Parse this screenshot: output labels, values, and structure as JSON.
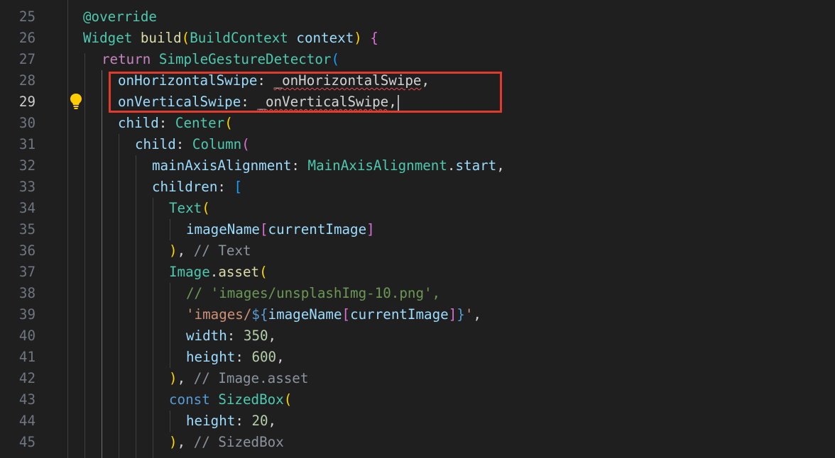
{
  "colors": {
    "background": "#1f1f1f",
    "line_number": "#6e7681",
    "highlight_box": "#e23b2e",
    "error_squiggle": "#f14c4c"
  },
  "editor": {
    "active_line": "29",
    "line_numbers": [
      "25",
      "26",
      "27",
      "28",
      "29",
      "30",
      "31",
      "32",
      "33",
      "34",
      "35",
      "36",
      "37",
      "38",
      "39",
      "40",
      "41",
      "42",
      "43",
      "44",
      "45"
    ],
    "code": {
      "l25": {
        "annotation": "@override"
      },
      "l26": {
        "type": "Widget",
        "method": "build",
        "p_open": "(",
        "param_type": "BuildContext",
        "param_name": "context",
        "p_close": ")",
        "brace": "{"
      },
      "l27": {
        "keyword": "return",
        "class": "SimpleGestureDetector",
        "paren": "("
      },
      "l28": {
        "prop": "onHorizontalSwipe",
        "colon": ":",
        "value": "_onHorizontalSwipe",
        "comma": ","
      },
      "l29": {
        "prop": "onVerticalSwipe",
        "colon": ":",
        "value": "_onVerticalSwipe",
        "comma": ","
      },
      "l30": {
        "prop": "child",
        "colon": ":",
        "class": "Center",
        "paren": "("
      },
      "l31": {
        "prop": "child",
        "colon": ":",
        "class": "Column",
        "paren": "("
      },
      "l32": {
        "prop": "mainAxisAlignment",
        "colon": ":",
        "class": "MainAxisAlignment",
        "dot": ".",
        "member": "start",
        "comma": ","
      },
      "l33": {
        "prop": "children",
        "colon": ":",
        "bracket": "["
      },
      "l34": {
        "class": "Text",
        "paren": "("
      },
      "l35": {
        "var": "imageName",
        "b_open": "[",
        "index": "currentImage",
        "b_close": "]"
      },
      "l36": {
        "close": ")",
        "comma": ",",
        "comment": "// Text"
      },
      "l37": {
        "class": "Image",
        "dot": ".",
        "member": "asset",
        "paren": "("
      },
      "l38": {
        "comment": "// 'images/unsplashImg-10.png',"
      },
      "l39": {
        "str_start": "'images/",
        "interp_open": "${",
        "var": "imageName",
        "b_open": "[",
        "index": "currentImage",
        "b_close": "]",
        "interp_close": "}",
        "str_end": "'",
        "comma": ","
      },
      "l40": {
        "prop": "width",
        "colon": ":",
        "value": "350",
        "comma": ","
      },
      "l41": {
        "prop": "height",
        "colon": ":",
        "value": "600",
        "comma": ","
      },
      "l42": {
        "close": ")",
        "comma": ",",
        "comment": "// Image.asset"
      },
      "l43": {
        "keyword": "const",
        "class": "SizedBox",
        "paren": "("
      },
      "l44": {
        "prop": "height",
        "colon": ":",
        "value": "20",
        "comma": ","
      },
      "l45": {
        "close": ")",
        "comma": ",",
        "comment": "// SizedBox"
      }
    }
  }
}
